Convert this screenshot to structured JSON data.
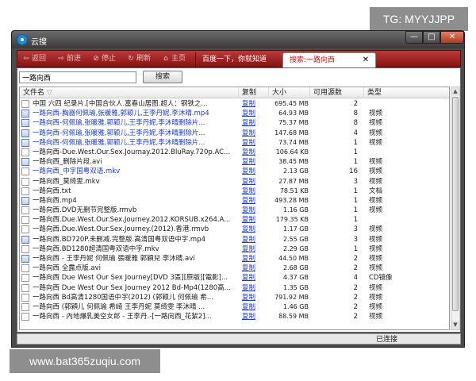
{
  "watermarks": {
    "top": "TG: MYYJJPP",
    "bottom": "www.bat365zuqiu.com"
  },
  "window": {
    "title": "云搜",
    "minimize": "—",
    "maximize": "□",
    "close": "✕"
  },
  "toolbar": {
    "back": "返回",
    "forward": "前进",
    "stop": "停止",
    "refresh": "刷新",
    "home": "主页",
    "tab_baidu": "百度一下，你就知道",
    "tab_search": "搜索:一路向西",
    "tab_close": "✕"
  },
  "search": {
    "value": "一路向西",
    "button": "搜索"
  },
  "columns": {
    "name": "文件名",
    "copy": "复制",
    "size": "大小",
    "sources": "可用源数",
    "type": "类型"
  },
  "rows": [
    {
      "name": "中国 六四 纪录片.[中国合伙人.富春山居图.超人：钢铁之...",
      "copy": "复制",
      "size": "695.45 MB",
      "sources": "2",
      "type": "",
      "icon": "file",
      "link": false
    },
    {
      "name": "一路向西-胸器何佩瑜,张暖雅,郭颖儿,王李丹妮,李沐晴.mp4",
      "copy": "复制",
      "size": "64.93 MB",
      "sources": "8",
      "type": "视频",
      "icon": "media",
      "link": true
    },
    {
      "name": "一路向西-何佩瑜,张暖雅,郭颖儿,王李丹妮,李沐晴删除片...",
      "copy": "复制",
      "size": "75.37 MB",
      "sources": "8",
      "type": "视频",
      "icon": "media",
      "link": true
    },
    {
      "name": "一路向西-何佩瑜,张暖雅,郭颖儿,王李丹妮,李沐晴删除片...",
      "copy": "复制",
      "size": "147.68 MB",
      "sources": "4",
      "type": "视频",
      "icon": "media",
      "link": true
    },
    {
      "name": "一路向西-何佩瑜,张暖雅,郭颖儿,王李丹妮,李沐晴删除片...",
      "copy": "复制",
      "size": "73.74 MB",
      "sources": "1",
      "type": "视频",
      "icon": "media",
      "link": true
    },
    {
      "name": "一路向西-Due.West.Our.Sex.Journay.2012.BluRay.720p.AC...",
      "copy": "复制",
      "size": "106.64 KB",
      "sources": "1",
      "type": "",
      "icon": "file",
      "link": false
    },
    {
      "name": "一路向西_删除片段.avi",
      "copy": "复制",
      "size": "38.45 MB",
      "sources": "1",
      "type": "视频",
      "icon": "media",
      "link": false
    },
    {
      "name": "一路向西_中字国粤双语.mkv",
      "copy": "复制",
      "size": "2.13 GB",
      "sources": "16",
      "type": "视频",
      "icon": "file",
      "link": true
    },
    {
      "name": "一路向西_莫绮雯.mkv",
      "copy": "复制",
      "size": "27.87 MB",
      "sources": "3",
      "type": "视频",
      "icon": "file",
      "link": false
    },
    {
      "name": "一路向西.txt",
      "copy": "复制",
      "size": "78.51 KB",
      "sources": "1",
      "type": "文档",
      "icon": "file",
      "link": false
    },
    {
      "name": "一路向西.mp4",
      "copy": "复制",
      "size": "493.28 MB",
      "sources": "1",
      "type": "视频",
      "icon": "media",
      "link": false
    },
    {
      "name": "一路向西.DVD无删节完整版.rmvb",
      "copy": "复制",
      "size": "1.16 GB",
      "sources": "1",
      "type": "视频",
      "icon": "file",
      "link": false
    },
    {
      "name": "一路向西.Due.West.Our.Sex.Journey.2012.KORSUB.x264.A...",
      "copy": "复制",
      "size": "179.35 KB",
      "sources": "1",
      "type": "",
      "icon": "file",
      "link": false
    },
    {
      "name": "一路向西.Due.West.Our.Sex.Journey.(2012).香港.rmvb",
      "copy": "复制",
      "size": "1.17 GB",
      "sources": "3",
      "type": "视频",
      "icon": "file",
      "link": false
    },
    {
      "name": "一路向西.BD720P.未删减.完整版.高清国粤双语中字.mp4",
      "copy": "复制",
      "size": "2.55 GB",
      "sources": "3",
      "type": "视频",
      "icon": "media",
      "link": false
    },
    {
      "name": "一路向西.BD1280超清国粤双语中字.mkv",
      "copy": "复制",
      "size": "2.29 GB",
      "sources": "1",
      "type": "视频",
      "icon": "file",
      "link": false
    },
    {
      "name": "一路向西 - 王李丹妮 何佩瑜 張暖雅 郭穎兒 李沐晴.avi",
      "copy": "复制",
      "size": "44.50 MB",
      "sources": "2",
      "type": "视频",
      "icon": "media",
      "link": false
    },
    {
      "name": "一路向西 全露点版.avi",
      "copy": "复制",
      "size": "2.68 GB",
      "sources": "2",
      "type": "视频",
      "icon": "file",
      "link": false
    },
    {
      "name": "一路向西 Due West Our Sex Journey[DVD 3區][原版][電影]...",
      "copy": "复制",
      "size": "4.37 GB",
      "sources": "4",
      "type": "CD镜像",
      "icon": "file",
      "link": false
    },
    {
      "name": "一路向西 Due West Our Sex Journey 2012 Bd-Mp4(1280高...",
      "copy": "复制",
      "size": "1.35 GB",
      "sources": "2",
      "type": "视频",
      "icon": "file",
      "link": false
    },
    {
      "name": "一路向西 Bd高清1280国语中字(2012) (郭颖儿 何佩瑜 希...",
      "copy": "复制",
      "size": "791.92 MB",
      "sources": "2",
      "type": "视频",
      "icon": "file",
      "link": false
    },
    {
      "name": "一路向西 (郭穎儿 何佩瑜 希崎 王李丹妮 莫绮雯 李沐晴 ...",
      "copy": "复制",
      "size": "1.46 GB",
      "sources": "2",
      "type": "视频",
      "icon": "file",
      "link": false
    },
    {
      "name": "一路向西 - 內地爆乳美空女郎 - 王李丹.-[一路向西_花絮2]...",
      "copy": "复制",
      "size": "88.59 MB",
      "sources": "2",
      "type": "视频",
      "icon": "file",
      "link": false
    }
  ],
  "status": "已连接"
}
